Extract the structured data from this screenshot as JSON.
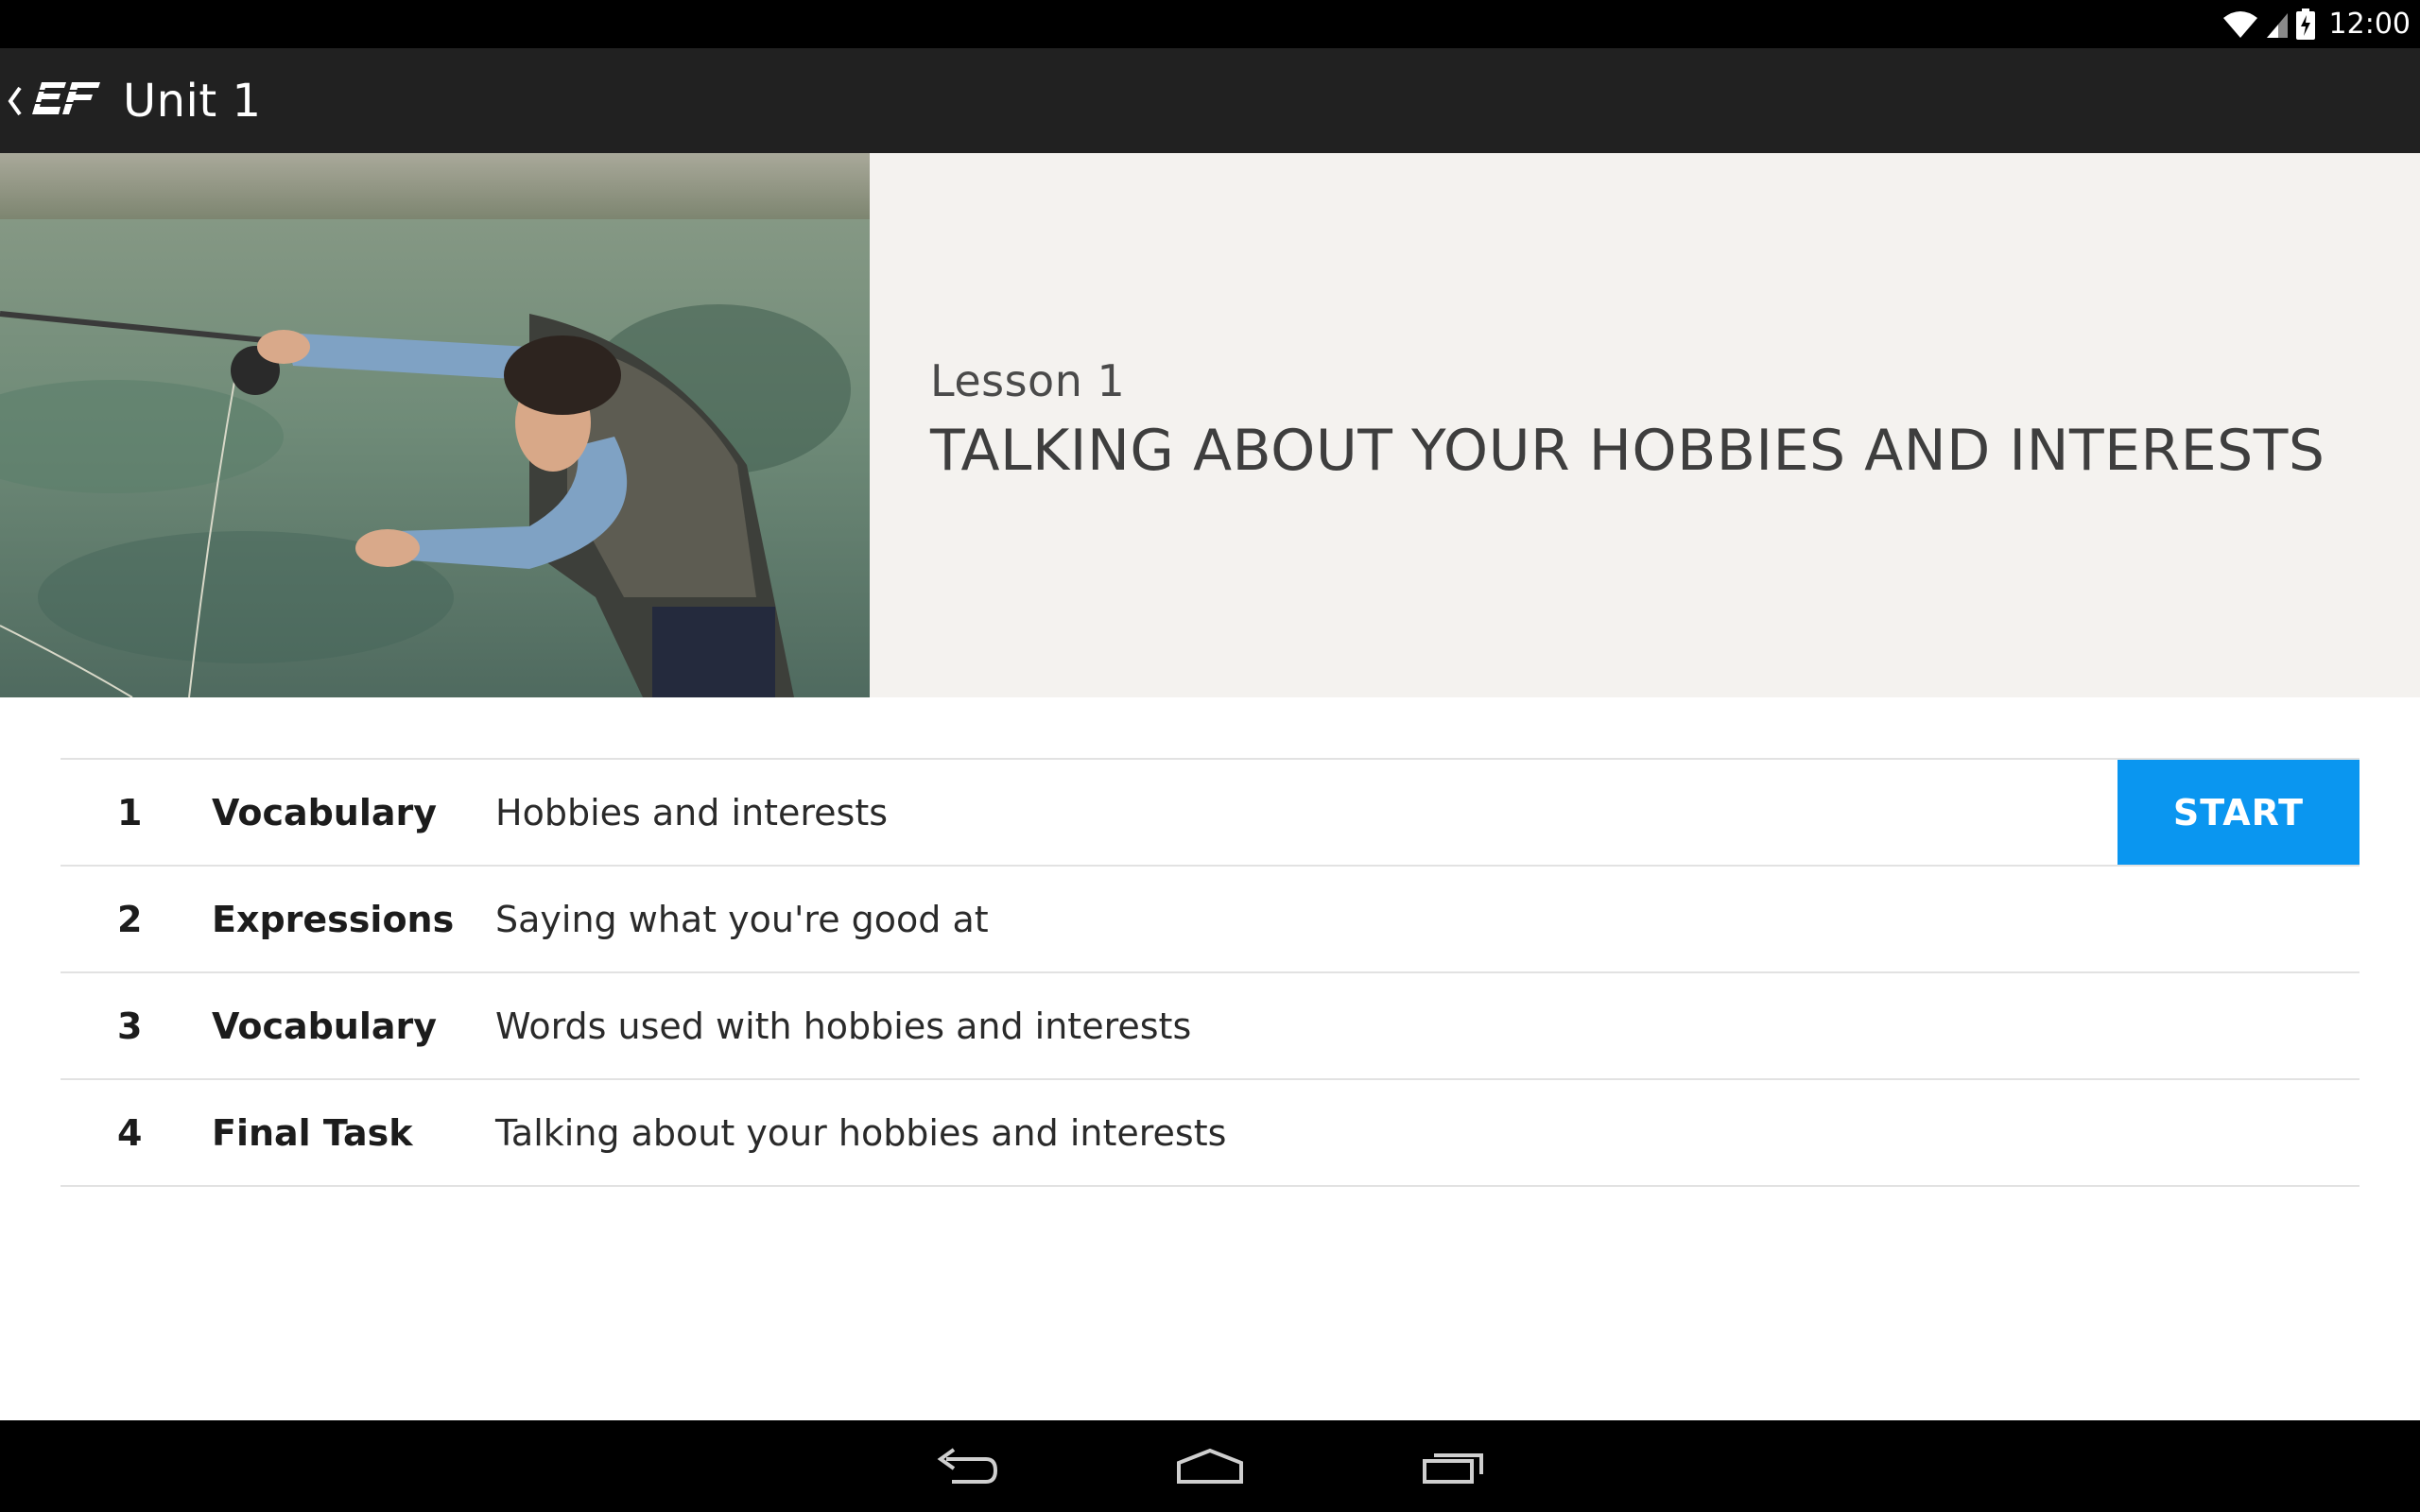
{
  "status_bar": {
    "time": "12:00",
    "icons": [
      "wifi-icon",
      "signal-icon",
      "battery-charging-icon"
    ]
  },
  "action_bar": {
    "back_icon": "chevron-left-icon",
    "logo": "EF",
    "title": "Unit 1"
  },
  "hero": {
    "image": "photo of a man fly fishing in a lake",
    "lesson_number": "Lesson 1",
    "lesson_title": "TALKING ABOUT YOUR HOBBIES AND INTERESTS"
  },
  "activities": [
    {
      "index": "1",
      "type": "Vocabulary",
      "description": "Hobbies and interests",
      "start_label": "START"
    },
    {
      "index": "2",
      "type": "Expressions",
      "description": "Saying what you're good at"
    },
    {
      "index": "3",
      "type": "Vocabulary",
      "description": "Words used with hobbies and interests"
    },
    {
      "index": "4",
      "type": "Final Task",
      "description": "Talking about your hobbies and interests"
    }
  ],
  "nav_bar": {
    "buttons": [
      "back-icon",
      "home-icon",
      "recent-apps-icon"
    ]
  },
  "colors": {
    "status_bar": "#000000",
    "action_bar": "#212121",
    "hero_background": "#f4f2ef",
    "accent": "#0a96f0",
    "divider": "#e2e2e2"
  }
}
